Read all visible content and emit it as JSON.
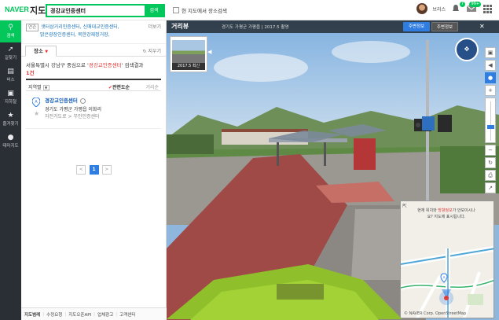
{
  "header": {
    "brand": "NAVER",
    "service": "지도",
    "search_value": "경강교인증센터",
    "search_button": "검색",
    "local_search_label": "현 지도에서 장소검색",
    "user_name": "브리스",
    "notification_count": "7",
    "mail_count": "99+"
  },
  "nav": {
    "items": [
      {
        "label": "검색",
        "icon": "search-icon",
        "active": true
      },
      {
        "label": "길찾기",
        "icon": "directions-icon"
      },
      {
        "label": "버스",
        "icon": "bus-icon"
      },
      {
        "label": "지하철",
        "icon": "subway-icon"
      },
      {
        "label": "즐겨찾기",
        "icon": "star-icon"
      },
      {
        "label": "테마지도",
        "icon": "pin-icon"
      }
    ]
  },
  "panel": {
    "related_tag": "연관",
    "related_line1": "샛터삼거리인증센터, 신매대교인증센터,",
    "related_line2": "밝은광장인증센터, 북한강재정거장,",
    "related_more": "더보기",
    "tab_label": "장소",
    "tab_clear": "지우기",
    "result_prefix": "서울특별시 강남구 중심으로 '",
    "result_query": "경강교인증센터",
    "result_suffix": "' 검색결과",
    "result_count": "1건",
    "filter_region": "지역별",
    "sort_relevance": "관련도순",
    "sort_distance": "거리순",
    "results": [
      {
        "marker": "A",
        "name": "경강교인증센터",
        "address": "경기도 가평군 가평읍 이화리",
        "category": "자전거도로 > 무인인증센터"
      }
    ],
    "pager": {
      "prev": "<",
      "current": "1",
      "next": ">"
    }
  },
  "footer": {
    "items": [
      "지도범례",
      "수정요청",
      "지도오픈API",
      "업체광고",
      "고객센터"
    ]
  },
  "streetview": {
    "title": "거리뷰",
    "location": "경기도 가평군 가평읍",
    "date": "2017.5 촬영",
    "btn_nearby": "주변정보",
    "btn_location": "주변정보",
    "thumb_caption": "2017.5 최신",
    "minimap_msg_pre": "현재 위치와 ",
    "minimap_msg_hl": "방향정보",
    "minimap_msg_post": "가 안보이시나요? 지도에 표시됩니다.",
    "minimap_attr": "© NAVER Corp. OpenStreetMap",
    "minimap_marker": "A"
  }
}
